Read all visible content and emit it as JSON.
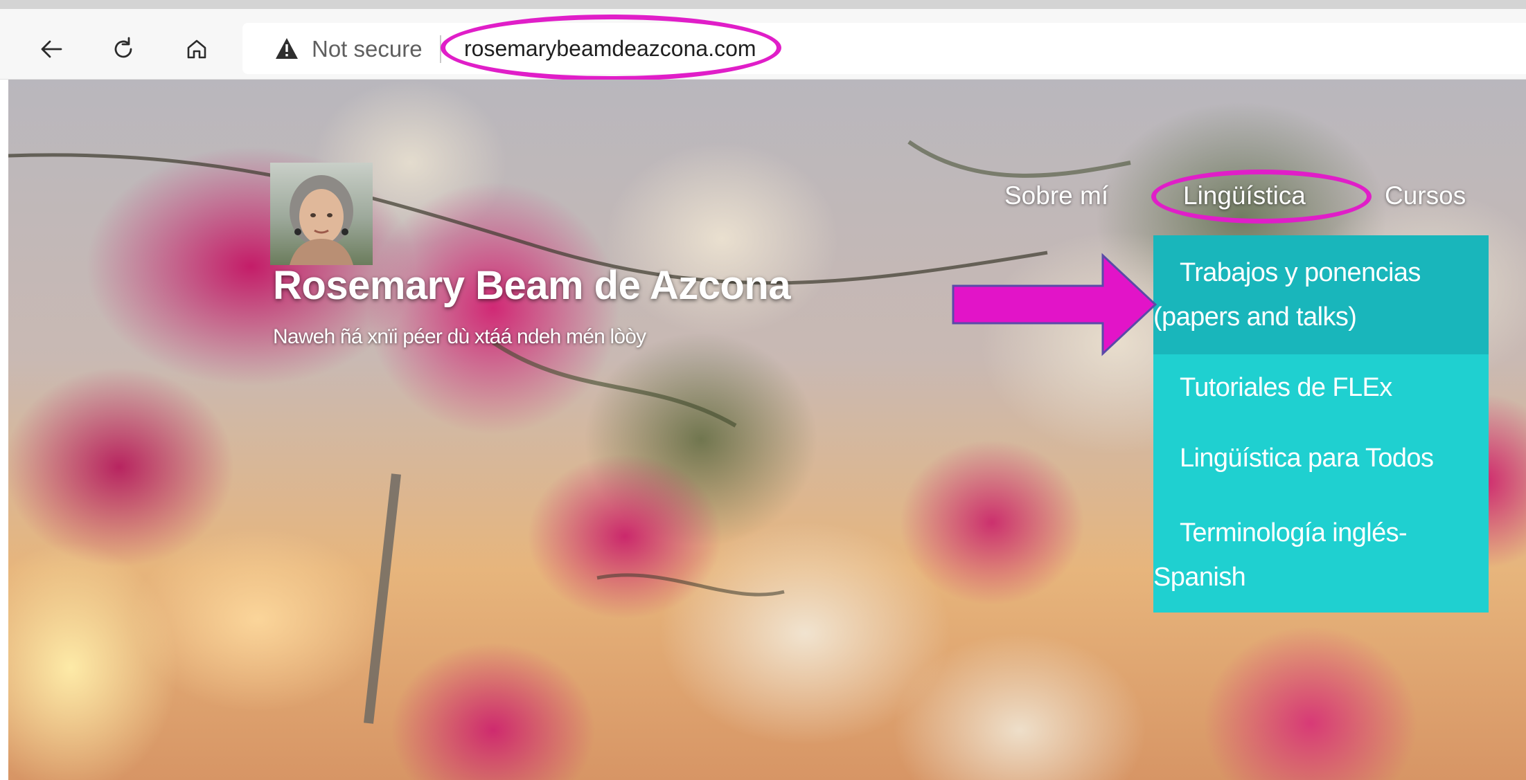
{
  "browser": {
    "url": "rosemarybeamdeazcona.com",
    "security_label": "Not secure",
    "icons": [
      "back-arrow-icon",
      "reload-icon",
      "home-icon",
      "warning-triangle-icon"
    ]
  },
  "site": {
    "title": "Rosemary Beam de Azcona",
    "tagline": "Naweh ñá xnïi péer dù xtáá ndeh mén lòòy"
  },
  "nav": {
    "items": [
      "Sobre mí",
      "Lingüística",
      "Cursos"
    ],
    "active": "Lingüística"
  },
  "dropdown": {
    "items": [
      "Trabajos y ponencias (papers and talks)",
      "Tutoriales de FLEx",
      "Lingüística para Todos",
      "Terminología inglés-Spanish"
    ]
  },
  "annotations": {
    "highlight_color": "#e01ec8",
    "dropdown_color": "#1fd0d0"
  }
}
